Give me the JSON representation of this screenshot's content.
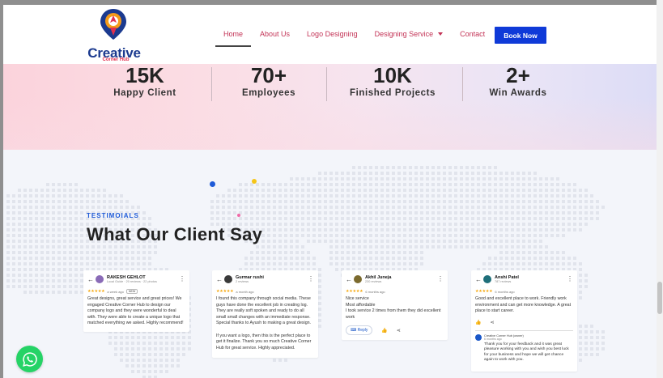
{
  "brand": {
    "title": "Creative",
    "subtitle": "Corner Hub"
  },
  "nav": {
    "items": [
      {
        "label": "Home"
      },
      {
        "label": "About Us"
      },
      {
        "label": "Logo Designing"
      },
      {
        "label": "Designing Service"
      },
      {
        "label": "Contact"
      }
    ],
    "cta": "Book Now"
  },
  "stats": [
    {
      "value": "15K",
      "label": "Happy Client"
    },
    {
      "value": "70+",
      "label": "Employees"
    },
    {
      "value": "10K",
      "label": "Finished Projects"
    },
    {
      "value": "2+",
      "label": "Win Awards"
    }
  ],
  "testimonials": {
    "eyebrow": "TESTIMOIALS",
    "heading": "What Our Client Say",
    "cards": [
      {
        "name": "RAKESH GEHLOT",
        "meta": "Local Guide · 20 reviews · 22 photos",
        "stars": "★★★★★",
        "ago": "a week ago",
        "badge": "NEW",
        "text": "Great designs, great service and great prices! We engaged Creative Corner Hub to design our company logo and they were wonderful to deal with. They were able to create a unique logo that matched everything we asked. Highly recommend!",
        "avatar_color": "#8a6bb7"
      },
      {
        "name": "Gurmar rushi",
        "meta": "2 reviews",
        "stars": "★★★★★",
        "ago": "a month ago",
        "text": "I found this company through social media. These guys have done the excellent job in creating log. They are really soft spoken and ready to do all small small changes with an immediate response. Special thanks to Ayush to making a great design.\n\nIf you want a logo, then this is the perfect place to get it finalize. Thank you so much Creative Corner Hub for great service. Highly appreciated.",
        "avatar_color": "#3a3a3a"
      },
      {
        "name": "Akhil Juneja",
        "meta": "230 reviews",
        "stars": "★★★★★",
        "ago": "6 months ago",
        "text": "Nice service\nMost affordable\nI took service 2 times from them they did excellent work",
        "reply": "Reply",
        "avatar_color": "#7b6a2e"
      },
      {
        "name": "Anshi Patel",
        "meta": "787 reviews",
        "stars": "★★★★★",
        "ago": "6 months ago",
        "text": "Good and excellent place to work. Friendly work environment and can get more knowledge. A great place to start career.",
        "owner_name": "Creative Corner Hub (owner)",
        "owner_time": "6 months ago",
        "owner_text": "Thank you for your feedback and it was great pleasure working with you and wish you best luck for your business and hope we will get chance again to work with you.",
        "avatar_color": "#1f6f7a"
      }
    ]
  },
  "colors": {
    "accent": "#0f3ad8",
    "nav_text": "#c33356",
    "brand_blue": "#1b3a8f",
    "whatsapp": "#25d366"
  },
  "icons": {
    "whatsapp": "whatsapp-icon",
    "logo": "location-pin-logo"
  }
}
